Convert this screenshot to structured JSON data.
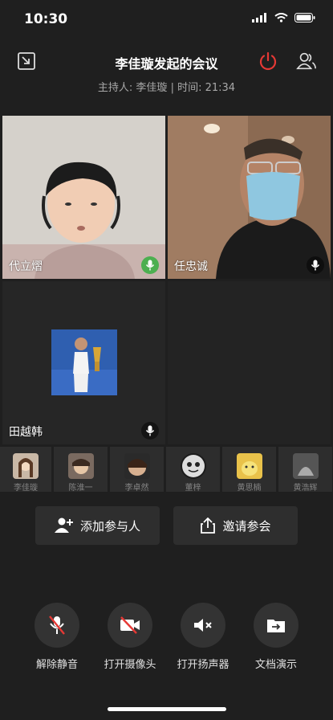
{
  "status_bar": {
    "time": "10:30"
  },
  "header": {
    "title": "李佳璇发起的会议",
    "subtitle": "主持人: 李佳璇 | 时间: 21:34"
  },
  "tiles": [
    {
      "name": "代立熠",
      "mic": "active",
      "mic_color": "#4caf50"
    },
    {
      "name": "任忠诚",
      "mic": "idle"
    },
    {
      "name": "田越韩",
      "mic": "idle"
    }
  ],
  "participants": [
    {
      "name": "李佳璇"
    },
    {
      "name": "陈淮一"
    },
    {
      "name": "李卓然"
    },
    {
      "name": "董梓"
    },
    {
      "name": "黄思楠"
    },
    {
      "name": "黄浩辉"
    }
  ],
  "actions": {
    "add_participant": "添加参与人",
    "invite": "邀请参会"
  },
  "controls": {
    "unmute": "解除静音",
    "camera": "打开摄像头",
    "speaker": "打开扬声器",
    "share_doc": "文档演示"
  },
  "colors": {
    "background": "#1f1f1f",
    "leave_red": "#e53935",
    "mic_green": "#4caf50",
    "mute_red": "#e53935"
  }
}
